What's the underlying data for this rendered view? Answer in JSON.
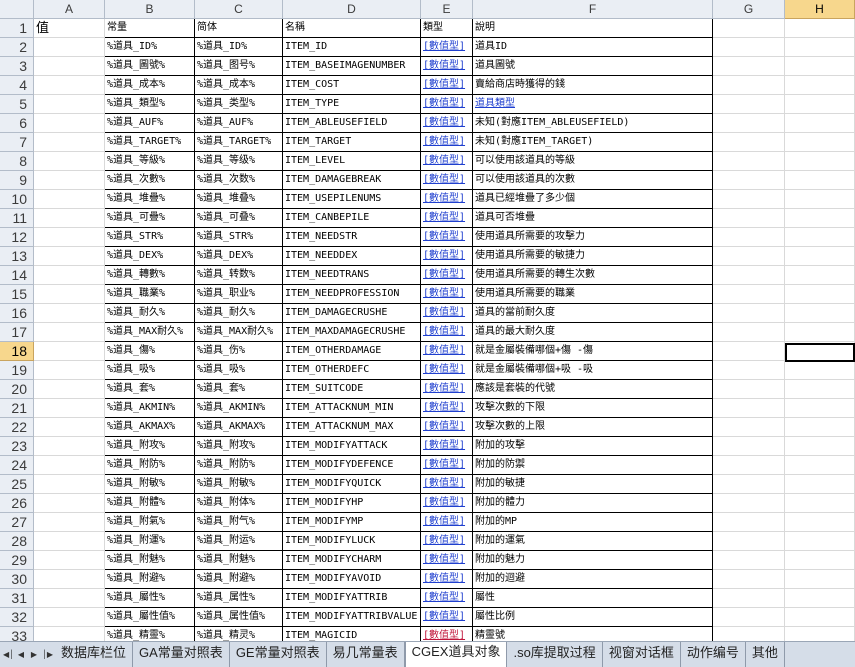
{
  "columns": [
    "A",
    "B",
    "C",
    "D",
    "E",
    "F",
    "G",
    "H"
  ],
  "selected_column": "H",
  "selected_row": "18",
  "header_row": {
    "a": "值",
    "b": "常量",
    "c": "简体",
    "d": "名稱",
    "e": "類型",
    "f": "說明"
  },
  "rows": [
    {
      "n": "2",
      "b": "%道具_ID%",
      "c": "%道具_ID%",
      "d": "ITEM_ID",
      "e": "[數值型]",
      "f": "道具ID"
    },
    {
      "n": "3",
      "b": "%道具_圖號%",
      "c": "%道具_图号%",
      "d": "ITEM_BASEIMAGENUMBER",
      "e": "[數值型]",
      "f": "道具圖號"
    },
    {
      "n": "4",
      "b": "%道具_成本%",
      "c": "%道具_成本%",
      "d": "ITEM_COST",
      "e": "[數值型]",
      "f": "賣給商店時獲得的錢"
    },
    {
      "n": "5",
      "b": "%道具_類型%",
      "c": "%道具_类型%",
      "d": "ITEM_TYPE",
      "e": "[數值型]",
      "f": "道具類型",
      "f_link": true
    },
    {
      "n": "6",
      "b": "%道具_AUF%",
      "c": "%道具_AUF%",
      "d": "ITEM_ABLEUSEFIELD",
      "e": "[數值型]",
      "f": "未知(對應ITEM_ABLEUSEFIELD)"
    },
    {
      "n": "7",
      "b": "%道具_TARGET%",
      "c": "%道具_TARGET%",
      "d": "ITEM_TARGET",
      "e": "[數值型]",
      "f": "未知(對應ITEM_TARGET)"
    },
    {
      "n": "8",
      "b": "%道具_等級%",
      "c": "%道具_等级%",
      "d": "ITEM_LEVEL",
      "e": "[數值型]",
      "f": "可以使用該道具的等級"
    },
    {
      "n": "9",
      "b": "%道具_次數%",
      "c": "%道具_次数%",
      "d": "ITEM_DAMAGEBREAK",
      "e": "[數值型]",
      "f": "可以使用該道具的次數"
    },
    {
      "n": "10",
      "b": "%道具_堆疊%",
      "c": "%道具_堆叠%",
      "d": "ITEM_USEPILENUMS",
      "e": "[數值型]",
      "f": "道具已經堆疊了多少個"
    },
    {
      "n": "11",
      "b": "%道具_可疊%",
      "c": "%道具_可叠%",
      "d": "ITEM_CANBEPILE",
      "e": "[數值型]",
      "f": "道具可否堆疊"
    },
    {
      "n": "12",
      "b": "%道具_STR%",
      "c": "%道具_STR%",
      "d": "ITEM_NEEDSTR",
      "e": "[數值型]",
      "f": "使用道具所需要的攻擊力"
    },
    {
      "n": "13",
      "b": "%道具_DEX%",
      "c": "%道具_DEX%",
      "d": "ITEM_NEEDDEX",
      "e": "[數值型]",
      "f": "使用道具所需要的敏捷力"
    },
    {
      "n": "14",
      "b": "%道具_轉數%",
      "c": "%道具_转数%",
      "d": "ITEM_NEEDTRANS",
      "e": "[數值型]",
      "f": "使用道具所需要的轉生次數"
    },
    {
      "n": "15",
      "b": "%道具_職業%",
      "c": "%道具_职业%",
      "d": "ITEM_NEEDPROFESSION",
      "e": "[數值型]",
      "f": "使用道具所需要的職業"
    },
    {
      "n": "16",
      "b": "%道具_耐久%",
      "c": "%道具_耐久%",
      "d": "ITEM_DAMAGECRUSHE",
      "e": "[數值型]",
      "f": "道具的當前耐久度"
    },
    {
      "n": "17",
      "b": "%道具_MAX耐久%",
      "c": "%道具_MAX耐久%",
      "d": "ITEM_MAXDAMAGECRUSHE",
      "e": "[數值型]",
      "f": "道具的最大耐久度"
    },
    {
      "n": "18",
      "b": "%道具_傷%",
      "c": "%道具_伤%",
      "d": "ITEM_OTHERDAMAGE",
      "e": "[數值型]",
      "f": "就是金屬裝備哪個+傷 -傷"
    },
    {
      "n": "19",
      "b": "%道具_吸%",
      "c": "%道具_吸%",
      "d": "ITEM_OTHERDEFC",
      "e": "[數值型]",
      "f": "就是金屬裝備哪個+吸 -吸"
    },
    {
      "n": "20",
      "b": "%道具_套%",
      "c": "%道具_套%",
      "d": "ITEM_SUITCODE",
      "e": "[數值型]",
      "f": "應該是套裝的代號"
    },
    {
      "n": "21",
      "b": "%道具_AKMIN%",
      "c": "%道具_AKMIN%",
      "d": "ITEM_ATTACKNUM_MIN",
      "e": "[數值型]",
      "f": "攻擊次數的下限"
    },
    {
      "n": "22",
      "b": "%道具_AKMAX%",
      "c": "%道具_AKMAX%",
      "d": "ITEM_ATTACKNUM_MAX",
      "e": "[數值型]",
      "f": "攻擊次數的上限"
    },
    {
      "n": "23",
      "b": "%道具_附攻%",
      "c": "%道具_附攻%",
      "d": "ITEM_MODIFYATTACK",
      "e": "[數值型]",
      "f": "附加的攻擊"
    },
    {
      "n": "24",
      "b": "%道具_附防%",
      "c": "%道具_附防%",
      "d": "ITEM_MODIFYDEFENCE",
      "e": "[數值型]",
      "f": "附加的防禦"
    },
    {
      "n": "25",
      "b": "%道具_附敏%",
      "c": "%道具_附敏%",
      "d": "ITEM_MODIFYQUICK",
      "e": "[數值型]",
      "f": "附加的敏捷"
    },
    {
      "n": "26",
      "b": "%道具_附體%",
      "c": "%道具_附体%",
      "d": "ITEM_MODIFYHP",
      "e": "[數值型]",
      "f": "附加的體力"
    },
    {
      "n": "27",
      "b": "%道具_附氣%",
      "c": "%道具_附气%",
      "d": "ITEM_MODIFYMP",
      "e": "[數值型]",
      "f": "附加的MP"
    },
    {
      "n": "28",
      "b": "%道具_附運%",
      "c": "%道具_附运%",
      "d": "ITEM_MODIFYLUCK",
      "e": "[數值型]",
      "f": "附加的運氣"
    },
    {
      "n": "29",
      "b": "%道具_附魅%",
      "c": "%道具_附魅%",
      "d": "ITEM_MODIFYCHARM",
      "e": "[數值型]",
      "f": "附加的魅力"
    },
    {
      "n": "30",
      "b": "%道具_附避%",
      "c": "%道具_附避%",
      "d": "ITEM_MODIFYAVOID",
      "e": "[數值型]",
      "f": "附加的迴避"
    },
    {
      "n": "31",
      "b": "%道具_屬性%",
      "c": "%道具_属性%",
      "d": "ITEM_MODIFYATTRIB",
      "e": "[數值型]",
      "f": "屬性"
    },
    {
      "n": "32",
      "b": "%道具_屬性值%",
      "c": "%道具_属性值%",
      "d": "ITEM_MODIFYATTRIBVALUE",
      "e": "[數值型]",
      "f": "屬性比例"
    },
    {
      "n": "33",
      "b": "%道具_精靈%",
      "c": "%道具_精灵%",
      "d": "ITEM_MAGICID",
      "e": "[數值型]",
      "f": "精靈號",
      "e_red": true
    }
  ],
  "sheet_tabs": [
    {
      "label": "数据库栏位",
      "active": false
    },
    {
      "label": "GA常量对照表",
      "active": false
    },
    {
      "label": "GE常量对照表",
      "active": false
    },
    {
      "label": "易几常量表",
      "active": false
    },
    {
      "label": "CGEX道具对象",
      "active": true
    },
    {
      "label": ".so库提取过程",
      "active": false
    },
    {
      "label": "视窗对话框",
      "active": false
    },
    {
      "label": "动作编号",
      "active": false
    },
    {
      "label": "其他",
      "active": false
    }
  ],
  "nav_icons": [
    "first-sheet-icon",
    "prev-sheet-icon",
    "next-sheet-icon",
    "last-sheet-icon"
  ]
}
